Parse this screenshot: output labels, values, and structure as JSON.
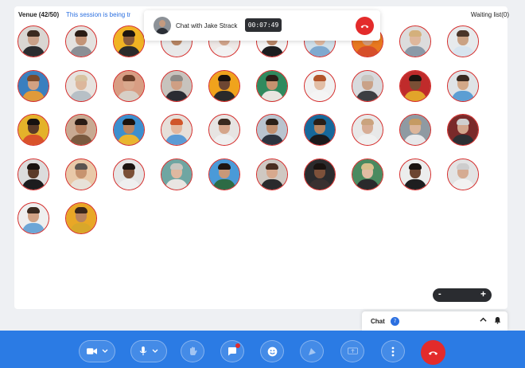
{
  "venue": {
    "label": "Venue (42/50)",
    "session_note": "This session is being tr",
    "waiting_list": "Waiting list(0)"
  },
  "chat_banner": {
    "title": "Chat with Jake Strack",
    "timer": "00:07:49"
  },
  "zoom": {
    "minus": "-",
    "plus": "+"
  },
  "chat_tab": {
    "label": "Chat",
    "count": "7"
  },
  "participants": [
    {
      "bg": "#d9d6d2",
      "skin": "#c9a189",
      "hair": "#3b2a20",
      "shirt": "#2c2d30"
    },
    {
      "bg": "#e4e2df",
      "skin": "#c39477",
      "hair": "#2a1c14",
      "shirt": "#8b8f95"
    },
    {
      "bg": "#f1b323",
      "skin": "#8a5b3c",
      "hair": "#1d1410",
      "shirt": "#2b2b2b"
    },
    {
      "bg": "#e8e8e8",
      "skin": "#b98663",
      "hair": "#1a1210",
      "shirt": "#e9e9e9"
    },
    {
      "bg": "#efe9e6",
      "skin": "#d3a68c",
      "hair": "#3d2418",
      "shirt": "#f2f2f2"
    },
    {
      "bg": "#f4f4f4",
      "skin": "#b98768",
      "hair": "#1d1714",
      "shirt": "#1d1d1f"
    },
    {
      "bg": "#d0e0ea",
      "skin": "#e0b9a0",
      "hair": "#c7a47a",
      "shirt": "#7fa9cf"
    },
    {
      "bg": "#e9791f",
      "skin": "#d39c7c",
      "hair": "#3b241a",
      "shirt": "#d64f2a"
    },
    {
      "bg": "#dcdcdc",
      "skin": "#deb79c",
      "hair": "#d4b07c",
      "shirt": "#8a9aa8"
    },
    {
      "bg": "#e7eaec",
      "skin": "#caa284",
      "hair": "#4a3528",
      "shirt": "#d7e4ef"
    },
    {
      "bg": "#3a7fbf",
      "skin": "#d2a182",
      "hair": "#7a4a2b",
      "shirt": "#e09a3a"
    },
    {
      "bg": "#e7e3df",
      "skin": "#dcb79c",
      "hair": "#d7c2a0",
      "shirt": "#b7c0c6"
    },
    {
      "bg": "#d89d83",
      "skin": "#d9a88d",
      "hair": "#6b3f2a",
      "shirt": "#d7cfc6"
    },
    {
      "bg": "#c7c3bd",
      "skin": "#cf9f84",
      "hair": "#8d8a86",
      "shirt": "#2a2c33"
    },
    {
      "bg": "#f0a31c",
      "skin": "#6d4632",
      "hair": "#1a120e",
      "shirt": "#2a2a2a"
    },
    {
      "bg": "#2f8a5e",
      "skin": "#c6926f",
      "hair": "#2d1f17",
      "shirt": "#e8e5e0"
    },
    {
      "bg": "#f1f1f1",
      "skin": "#e2bea5",
      "hair": "#b3542a",
      "shirt": "#f4f4f4"
    },
    {
      "bg": "#d8dadd",
      "skin": "#c9a288",
      "hair": "#c8c5c0",
      "shirt": "#3c3e42"
    },
    {
      "bg": "#c02b2b",
      "skin": "#7a4f35",
      "hair": "#1c140f",
      "shirt": "#e2a42a"
    },
    {
      "bg": "#dfe3e6",
      "skin": "#d2a888",
      "hair": "#3a2a20",
      "shirt": "#5c9ed3"
    },
    {
      "bg": "#e4b22a",
      "skin": "#5b3a27",
      "hair": "#171110",
      "shirt": "#d9522a"
    },
    {
      "bg": "#c8aa92",
      "skin": "#b7805e",
      "hair": "#2a1c14",
      "shirt": "#7a5a3f"
    },
    {
      "bg": "#3c8fcf",
      "skin": "#b9845f",
      "hair": "#1b130e",
      "shirt": "#e9b52f"
    },
    {
      "bg": "#e6dfd9",
      "skin": "#e3b79e",
      "hair": "#d0552a",
      "shirt": "#5b9bd5"
    },
    {
      "bg": "#e7e4e2",
      "skin": "#d5a58a",
      "hair": "#3a2a1f",
      "shirt": "#efefef"
    },
    {
      "bg": "#b9c4cf",
      "skin": "#c08f6f",
      "hair": "#2b2018",
      "shirt": "#2c3440"
    },
    {
      "bg": "#16689b",
      "skin": "#b58460",
      "hair": "#2a1f17",
      "shirt": "#1a1a1c"
    },
    {
      "bg": "#e8e8e8",
      "skin": "#d7ad95",
      "hair": "#caa37e",
      "shirt": "#f0f0f0"
    },
    {
      "bg": "#8f9aa2",
      "skin": "#dcb59a",
      "hair": "#c59a63",
      "shirt": "#e7e8ea"
    },
    {
      "bg": "#7a2a2a",
      "skin": "#d2a58c",
      "hair": "#cfcfcf",
      "shirt": "#2c2f33"
    },
    {
      "bg": "#dcdcdc",
      "skin": "#5b3b29",
      "hair": "#1a1310",
      "shirt": "#1c1c1e"
    },
    {
      "bg": "#e9c9a8",
      "skin": "#c7946f",
      "hair": "#5a5450",
      "shirt": "#e7e1d8"
    },
    {
      "bg": "#e5e5e5",
      "skin": "#7a4f36",
      "hair": "#1c1410",
      "shirt": "#efefef"
    },
    {
      "bg": "#6fa6a2",
      "skin": "#deb8a0",
      "hair": "#c9c6c0",
      "shirt": "#e9e6e2"
    },
    {
      "bg": "#4a9ad8",
      "skin": "#c89878",
      "hair": "#1f1612",
      "shirt": "#2d6b45"
    },
    {
      "bg": "#cfc8c2",
      "skin": "#d7a98e",
      "hair": "#4a2e20",
      "shirt": "#2a2a2c"
    },
    {
      "bg": "#2b2b2d",
      "skin": "#7d513a",
      "hair": "#1a1310",
      "shirt": "#3a3030"
    },
    {
      "bg": "#4a8a60",
      "skin": "#e1bca4",
      "hair": "#d9bf8c",
      "shirt": "#2a2a2c"
    },
    {
      "bg": "#eceded",
      "skin": "#6c4532",
      "hair": "#1a1310",
      "shirt": "#1e1e20"
    },
    {
      "bg": "#e3e3e3",
      "skin": "#d5ab92",
      "hair": "#cdcdcd",
      "shirt": "#f2f2f2"
    },
    {
      "bg": "#efefef",
      "skin": "#d2a385",
      "hair": "#3a2a1f",
      "shirt": "#6da6d6"
    },
    {
      "bg": "#e9a726",
      "skin": "#b8835f",
      "hair": "#3a261a",
      "shirt": "#d8a72a"
    }
  ],
  "toolbar": {
    "buttons": [
      {
        "name": "camera",
        "icon": "video-icon"
      },
      {
        "name": "microphone",
        "icon": "mic-icon"
      },
      {
        "name": "raise-hand",
        "icon": "hand-icon"
      },
      {
        "name": "chat",
        "icon": "chat-icon"
      },
      {
        "name": "reactions",
        "icon": "emoji-icon"
      },
      {
        "name": "draw",
        "icon": "pen-icon"
      },
      {
        "name": "share-screen",
        "icon": "screen-share-icon"
      },
      {
        "name": "more",
        "icon": "more-icon"
      },
      {
        "name": "leave",
        "icon": "hangup-icon"
      }
    ]
  }
}
